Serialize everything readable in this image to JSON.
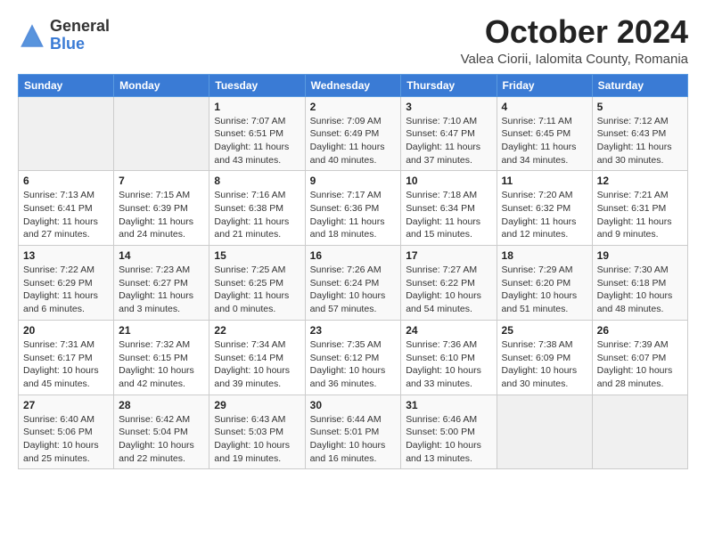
{
  "header": {
    "logo_general": "General",
    "logo_blue": "Blue",
    "month_title": "October 2024",
    "location": "Valea Ciorii, Ialomita County, Romania"
  },
  "weekdays": [
    "Sunday",
    "Monday",
    "Tuesday",
    "Wednesday",
    "Thursday",
    "Friday",
    "Saturday"
  ],
  "weeks": [
    [
      null,
      null,
      {
        "day": 1,
        "sunrise": "7:07 AM",
        "sunset": "6:51 PM",
        "daylight": "11 hours and 43 minutes."
      },
      {
        "day": 2,
        "sunrise": "7:09 AM",
        "sunset": "6:49 PM",
        "daylight": "11 hours and 40 minutes."
      },
      {
        "day": 3,
        "sunrise": "7:10 AM",
        "sunset": "6:47 PM",
        "daylight": "11 hours and 37 minutes."
      },
      {
        "day": 4,
        "sunrise": "7:11 AM",
        "sunset": "6:45 PM",
        "daylight": "11 hours and 34 minutes."
      },
      {
        "day": 5,
        "sunrise": "7:12 AM",
        "sunset": "6:43 PM",
        "daylight": "11 hours and 30 minutes."
      }
    ],
    [
      {
        "day": 6,
        "sunrise": "7:13 AM",
        "sunset": "6:41 PM",
        "daylight": "11 hours and 27 minutes."
      },
      {
        "day": 7,
        "sunrise": "7:15 AM",
        "sunset": "6:39 PM",
        "daylight": "11 hours and 24 minutes."
      },
      {
        "day": 8,
        "sunrise": "7:16 AM",
        "sunset": "6:38 PM",
        "daylight": "11 hours and 21 minutes."
      },
      {
        "day": 9,
        "sunrise": "7:17 AM",
        "sunset": "6:36 PM",
        "daylight": "11 hours and 18 minutes."
      },
      {
        "day": 10,
        "sunrise": "7:18 AM",
        "sunset": "6:34 PM",
        "daylight": "11 hours and 15 minutes."
      },
      {
        "day": 11,
        "sunrise": "7:20 AM",
        "sunset": "6:32 PM",
        "daylight": "11 hours and 12 minutes."
      },
      {
        "day": 12,
        "sunrise": "7:21 AM",
        "sunset": "6:31 PM",
        "daylight": "11 hours and 9 minutes."
      }
    ],
    [
      {
        "day": 13,
        "sunrise": "7:22 AM",
        "sunset": "6:29 PM",
        "daylight": "11 hours and 6 minutes."
      },
      {
        "day": 14,
        "sunrise": "7:23 AM",
        "sunset": "6:27 PM",
        "daylight": "11 hours and 3 minutes."
      },
      {
        "day": 15,
        "sunrise": "7:25 AM",
        "sunset": "6:25 PM",
        "daylight": "11 hours and 0 minutes."
      },
      {
        "day": 16,
        "sunrise": "7:26 AM",
        "sunset": "6:24 PM",
        "daylight": "10 hours and 57 minutes."
      },
      {
        "day": 17,
        "sunrise": "7:27 AM",
        "sunset": "6:22 PM",
        "daylight": "10 hours and 54 minutes."
      },
      {
        "day": 18,
        "sunrise": "7:29 AM",
        "sunset": "6:20 PM",
        "daylight": "10 hours and 51 minutes."
      },
      {
        "day": 19,
        "sunrise": "7:30 AM",
        "sunset": "6:18 PM",
        "daylight": "10 hours and 48 minutes."
      }
    ],
    [
      {
        "day": 20,
        "sunrise": "7:31 AM",
        "sunset": "6:17 PM",
        "daylight": "10 hours and 45 minutes."
      },
      {
        "day": 21,
        "sunrise": "7:32 AM",
        "sunset": "6:15 PM",
        "daylight": "10 hours and 42 minutes."
      },
      {
        "day": 22,
        "sunrise": "7:34 AM",
        "sunset": "6:14 PM",
        "daylight": "10 hours and 39 minutes."
      },
      {
        "day": 23,
        "sunrise": "7:35 AM",
        "sunset": "6:12 PM",
        "daylight": "10 hours and 36 minutes."
      },
      {
        "day": 24,
        "sunrise": "7:36 AM",
        "sunset": "6:10 PM",
        "daylight": "10 hours and 33 minutes."
      },
      {
        "day": 25,
        "sunrise": "7:38 AM",
        "sunset": "6:09 PM",
        "daylight": "10 hours and 30 minutes."
      },
      {
        "day": 26,
        "sunrise": "7:39 AM",
        "sunset": "6:07 PM",
        "daylight": "10 hours and 28 minutes."
      }
    ],
    [
      {
        "day": 27,
        "sunrise": "6:40 AM",
        "sunset": "5:06 PM",
        "daylight": "10 hours and 25 minutes."
      },
      {
        "day": 28,
        "sunrise": "6:42 AM",
        "sunset": "5:04 PM",
        "daylight": "10 hours and 22 minutes."
      },
      {
        "day": 29,
        "sunrise": "6:43 AM",
        "sunset": "5:03 PM",
        "daylight": "10 hours and 19 minutes."
      },
      {
        "day": 30,
        "sunrise": "6:44 AM",
        "sunset": "5:01 PM",
        "daylight": "10 hours and 16 minutes."
      },
      {
        "day": 31,
        "sunrise": "6:46 AM",
        "sunset": "5:00 PM",
        "daylight": "10 hours and 13 minutes."
      },
      null,
      null
    ]
  ],
  "labels": {
    "sunrise": "Sunrise:",
    "sunset": "Sunset:",
    "daylight": "Daylight hours"
  }
}
